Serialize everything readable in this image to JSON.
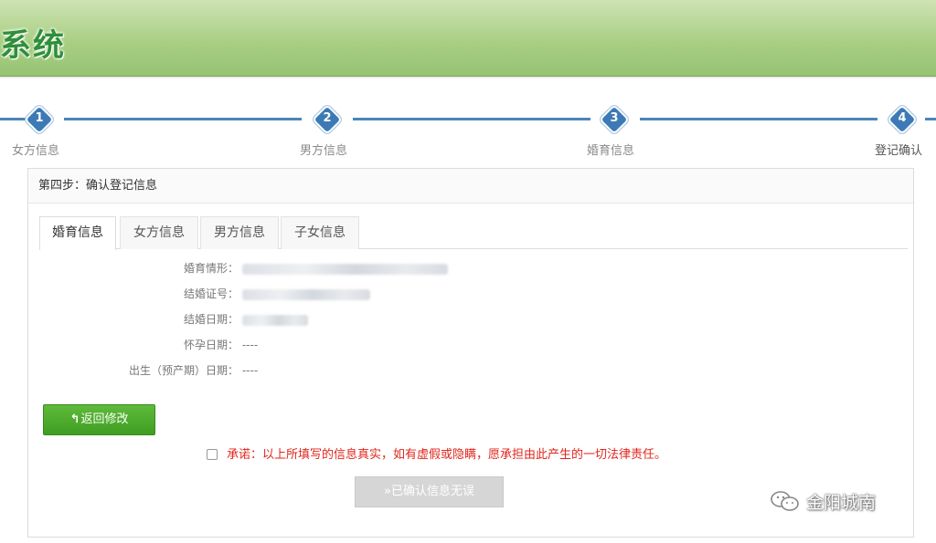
{
  "header": {
    "title": "系统"
  },
  "steps": [
    {
      "number": "1",
      "label": "女方信息"
    },
    {
      "number": "2",
      "label": "男方信息"
    },
    {
      "number": "3",
      "label": "婚育信息"
    },
    {
      "number": "4",
      "label": "登记确认"
    }
  ],
  "panel": {
    "heading": "第四步：确认登记信息",
    "tabs": [
      "婚育信息",
      "女方信息",
      "男方信息",
      "子女信息"
    ],
    "fields": [
      {
        "label": "婚育情形：",
        "value": ""
      },
      {
        "label": "结婚证号：",
        "value": ""
      },
      {
        "label": "结婚日期：",
        "value": ""
      },
      {
        "label": "怀孕日期：",
        "value": "----"
      },
      {
        "label": "出生（预产期）日期：",
        "value": "----"
      }
    ],
    "back_button": "返回修改",
    "pledge_text": "承诺：以上所填写的信息真实，如有虚假或隐瞒，愿承担由此产生的一切法律责任。",
    "confirm_button": "已确认信息无误"
  },
  "watermark": {
    "text": "金阳城南"
  },
  "colors": {
    "accent_blue": "#3d7ab5",
    "button_green": "#4aa82b",
    "pledge_red": "#e0261c",
    "banner_green": "#a9cf84"
  }
}
